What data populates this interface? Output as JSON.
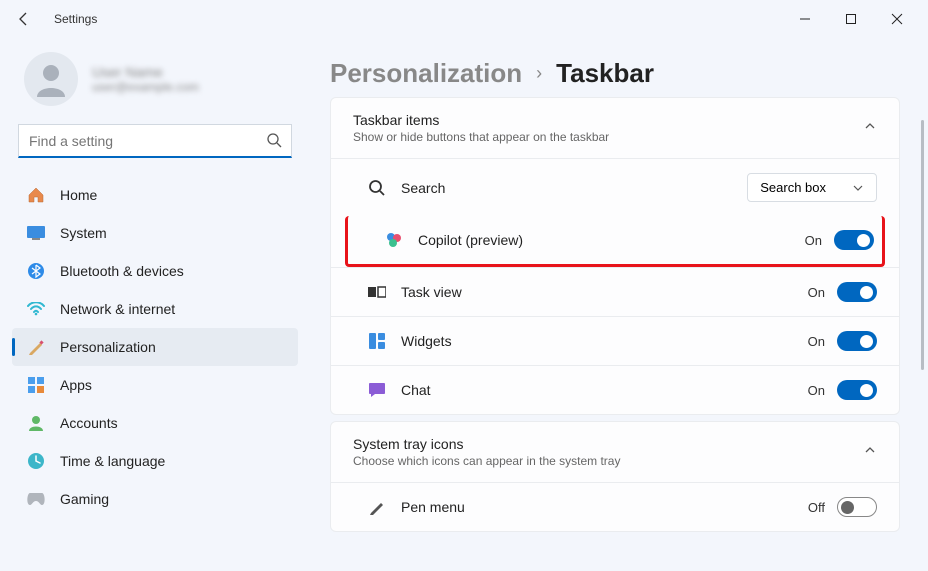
{
  "window": {
    "title": "Settings"
  },
  "user": {
    "name": "User Name",
    "email": "user@example.com"
  },
  "search": {
    "placeholder": "Find a setting"
  },
  "nav": [
    {
      "label": "Home",
      "icon": "home"
    },
    {
      "label": "System",
      "icon": "system"
    },
    {
      "label": "Bluetooth & devices",
      "icon": "bluetooth"
    },
    {
      "label": "Network & internet",
      "icon": "network"
    },
    {
      "label": "Personalization",
      "icon": "personalization",
      "active": true
    },
    {
      "label": "Apps",
      "icon": "apps"
    },
    {
      "label": "Accounts",
      "icon": "accounts"
    },
    {
      "label": "Time & language",
      "icon": "time"
    },
    {
      "label": "Gaming",
      "icon": "gaming"
    }
  ],
  "breadcrumb": {
    "parent": "Personalization",
    "current": "Taskbar"
  },
  "sections": {
    "items": {
      "title": "Taskbar items",
      "subtitle": "Show or hide buttons that appear on the taskbar",
      "rows": [
        {
          "label": "Search",
          "control": "select",
          "value": "Search box"
        },
        {
          "label": "Copilot (preview)",
          "control": "toggle",
          "state": "On",
          "on": true,
          "highlight": true
        },
        {
          "label": "Task view",
          "control": "toggle",
          "state": "On",
          "on": true
        },
        {
          "label": "Widgets",
          "control": "toggle",
          "state": "On",
          "on": true
        },
        {
          "label": "Chat",
          "control": "toggle",
          "state": "On",
          "on": true
        }
      ]
    },
    "tray": {
      "title": "System tray icons",
      "subtitle": "Choose which icons can appear in the system tray",
      "rows": [
        {
          "label": "Pen menu",
          "control": "toggle",
          "state": "Off",
          "on": false
        }
      ]
    }
  }
}
